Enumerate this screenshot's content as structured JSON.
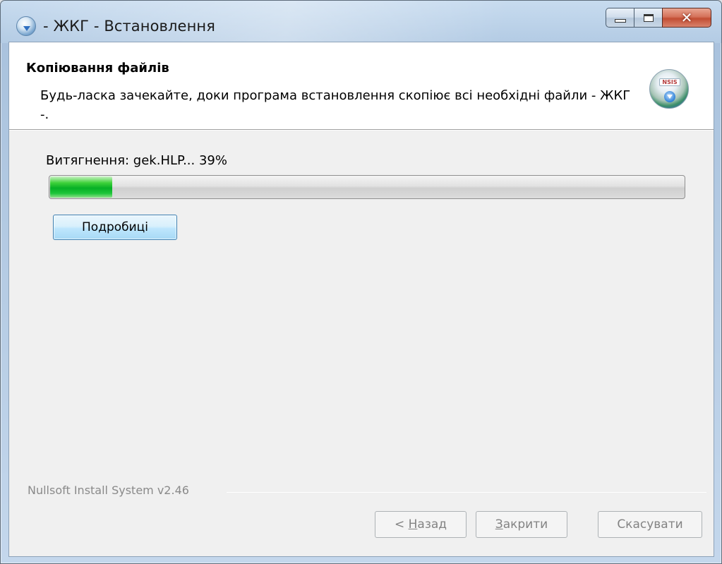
{
  "window": {
    "title": "- ЖКГ - Встановлення",
    "icons": {
      "app": "installer-globe-icon",
      "minimize": "minimize-icon",
      "maximize": "maximize-icon",
      "close": "close-icon"
    },
    "close_glyph": "✕"
  },
  "header": {
    "title": "Копіювання файлів",
    "description": "Будь-ласка зачекайте, доки програма встановлення скопіює всі необхідні файли - ЖКГ -.",
    "logo_icon": "nsis-installer-icon",
    "logo_badge": "NSIS"
  },
  "progress": {
    "status_text": "Витягнення: gek.HLP... 39%",
    "fill_fraction": 0.1,
    "bar_color": "#06b025"
  },
  "details_button": {
    "label": "Подробиці"
  },
  "footer": {
    "branding": "Nullsoft Install System v2.46",
    "back": {
      "prefix": "< ",
      "mnemonic": "Н",
      "rest": "азад"
    },
    "close": {
      "prefix": "",
      "mnemonic": "З",
      "rest": "акрити"
    },
    "cancel": {
      "label": "Скасувати"
    }
  }
}
